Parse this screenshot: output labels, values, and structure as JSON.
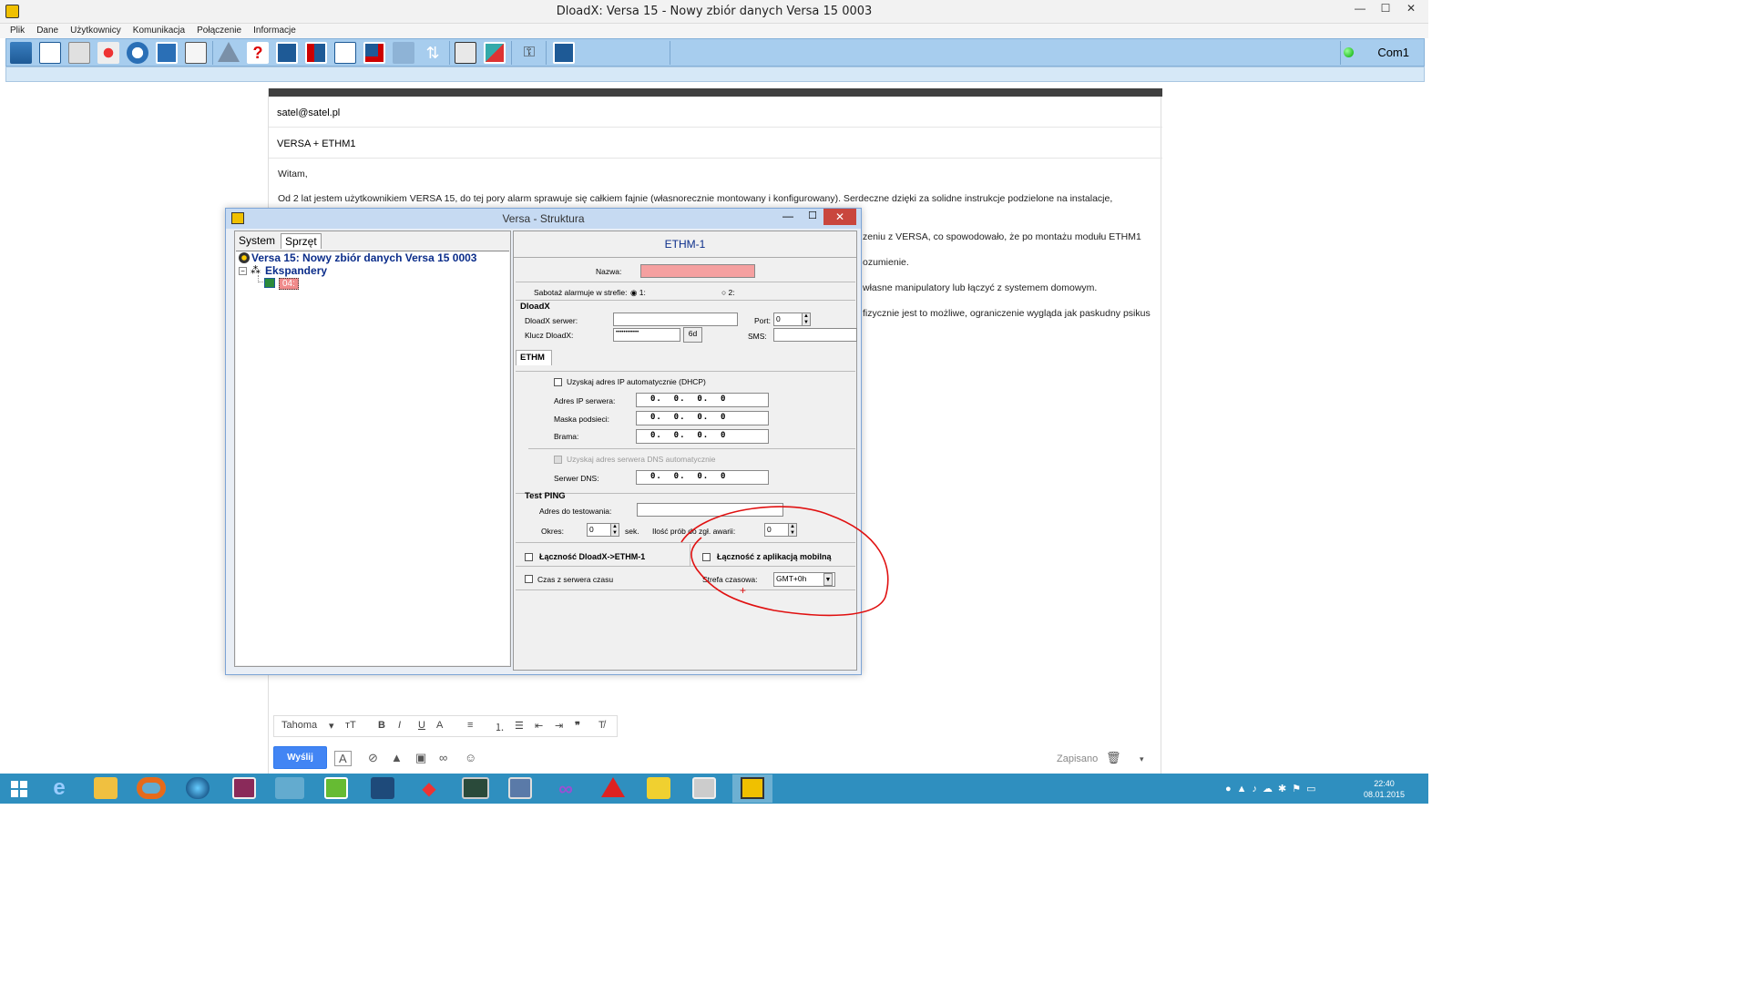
{
  "main_window": {
    "title": "DloadX: Versa 15 - Nowy zbiór danych Versa 15 0003",
    "minimize": "—",
    "maximize": "☐",
    "close": "✕"
  },
  "menu": {
    "items": [
      "Plik",
      "Dane",
      "Użytkownicy",
      "Komunikacja",
      "Połączenie",
      "Informacje"
    ]
  },
  "toolbar": {
    "icons": [
      "structure-icon",
      "checklist-icon",
      "module-icon",
      "alarm-icon",
      "clock-icon",
      "monitor-icon",
      "phone-icon",
      "triangle-icon",
      "question-icon",
      "upload-icon",
      "download-icon",
      "document-icon",
      "monitor-red-icon",
      "blank-icon",
      "arrows-icon",
      "calculator-icon",
      "image-icon",
      "key-icon",
      "screen-icon"
    ],
    "connection_label": "Com1",
    "connection_color": "#00aa00"
  },
  "email": {
    "to": "satel@satel.pl",
    "subject": "VERSA + ETHM1",
    "greeting": "Witam,",
    "line1": "Od 2 lat jestem użytkownikiem VERSA 15, do tej pory alarm sprawuje się całkiem fajnie (własnorecznie montowany i konfigurowany). Serdeczne dzięki za solidne instrukcje podzielone na instalacje,",
    "line2_fragment": "zeniu z VERSA, co spowodowało, że po montażu modułu ETHM1",
    "line3_fragment": "ozumienie.",
    "line4_fragment": "własne manipulatory lub łączyć z systemem domowym.",
    "line5_fragment": "fizycznie jest to możliwe, ograniczenie wygląda jak paskudny psikus",
    "font_name": "Tahoma",
    "send_label": "Wyślij",
    "saved_label": "Zapisano"
  },
  "dialog": {
    "title": "Versa - Struktura",
    "tabs": [
      "System",
      "Sprzęt"
    ],
    "tree": {
      "root": "Versa 15: Nowy zbiór danych Versa 15 0003",
      "group": "Ekspandery",
      "leaf": "04:"
    },
    "panel_title": "ETHM-1",
    "nazwa_label": "Nazwa:",
    "sabotaz_label": "Sabotaż alarmuje w strefie:",
    "radio1": "1:",
    "radio2": "2:",
    "dloadx_group": "DloadX",
    "dloadx_server_label": "DloadX serwer:",
    "port_label": "Port:",
    "port_value": "0",
    "klucz_label": "Klucz DloadX:",
    "klucz_value": "••••••••••••",
    "klucz_btn": "6d",
    "sms_label": "SMS:",
    "ethm_tab": "ETHM",
    "dhcp_label": "Uzyskaj adres IP automatycznie (DHCP)",
    "ip_label": "Adres IP serwera:",
    "ip_value": "0.  0.  0.  0",
    "mask_label": "Maska podsieci:",
    "mask_value": "0.  0.  0.  0",
    "gateway_label": "Brama:",
    "gateway_value": "0.  0.  0.  0",
    "dns_auto_label": "Uzyskaj adres serwera DNS automatycznie",
    "dns_label": "Serwer DNS:",
    "dns_value": "0.  0.  0.  0",
    "ping_group": "Test PING",
    "ping_addr_label": "Adres do testowania:",
    "okres_label": "Okres:",
    "okres_value": "0",
    "sek_label": "sek.",
    "proby_label": "Ilość prób do zgł. awarii:",
    "proby_value": "0",
    "lacznosc_dloadx": "Łączność DloadX->ETHM-1",
    "lacznosc_mobile": "Łączność z aplikacją mobilną",
    "czas_label": "Czas z serwera czasu",
    "strefa_label": "Strefa czasowa:",
    "strefa_value": "GMT+0h"
  },
  "taskbar": {
    "time": "22:40",
    "date": "08.01.2015"
  }
}
